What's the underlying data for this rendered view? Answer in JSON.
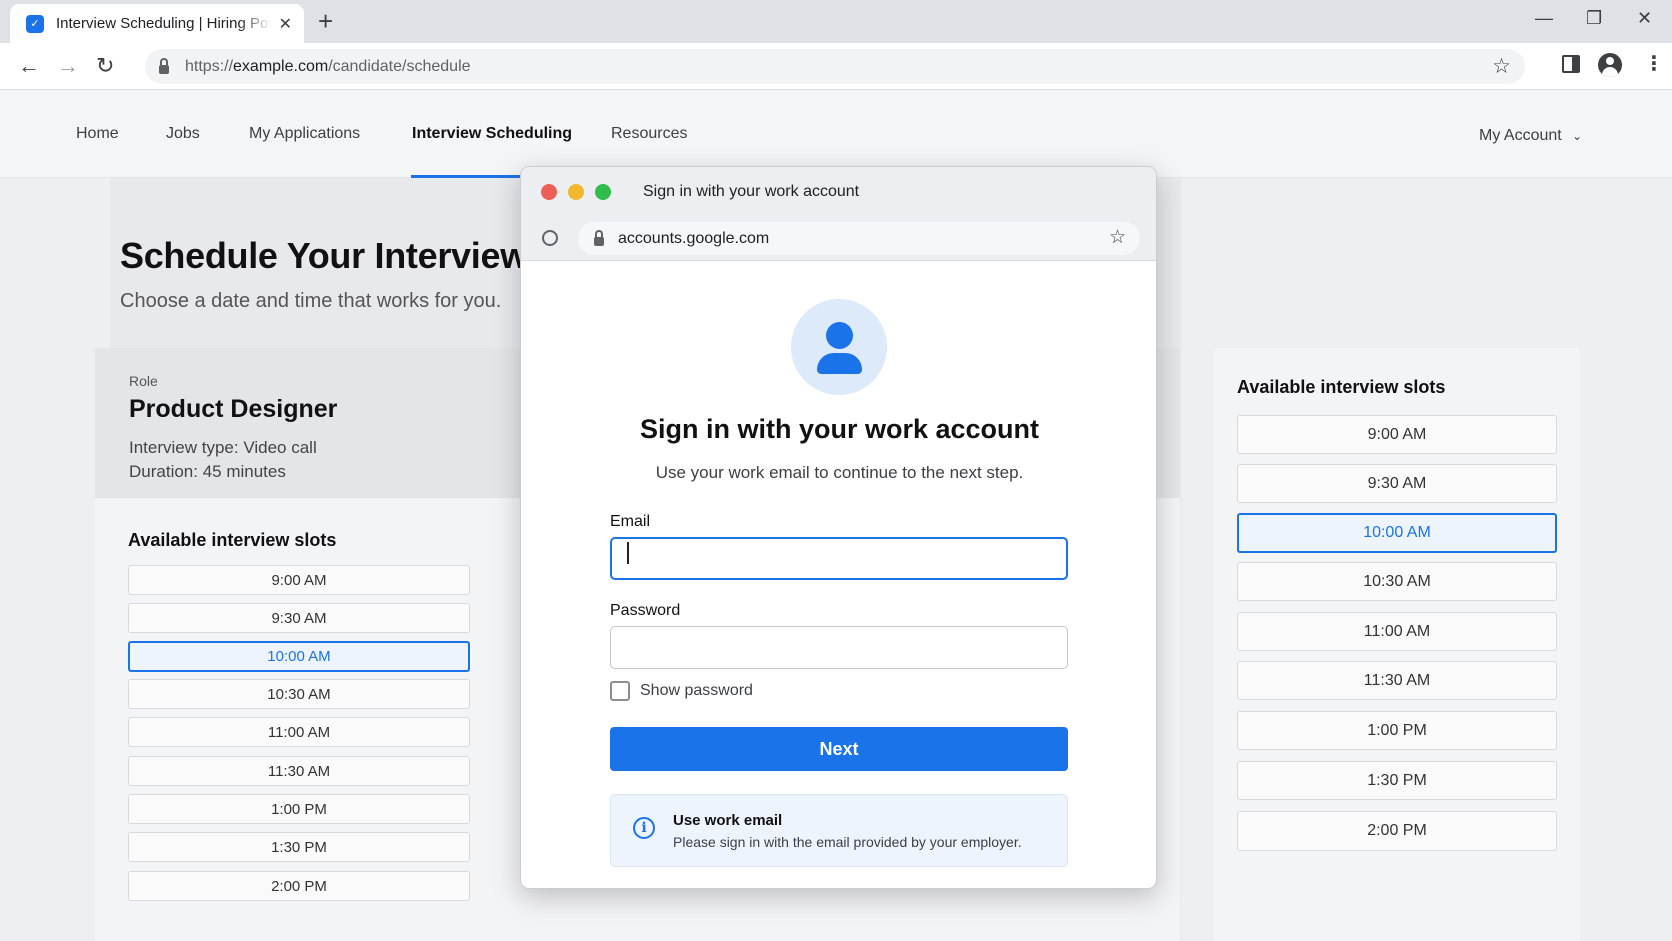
{
  "browser": {
    "tab_title": "Interview Scheduling | Hiring Portal",
    "tab_icon": "portal-favicon",
    "url_prefix": "https://",
    "url_host": "example.com",
    "url_path": "/candidate/schedule"
  },
  "site_nav": {
    "items": [
      "Home",
      "Jobs",
      "My Applications",
      "Interview Scheduling",
      "Resources"
    ],
    "active": "Interview Scheduling",
    "account_label": "My Account"
  },
  "page": {
    "title": "Schedule Your Interview",
    "subtitle": "Choose a date and time that works for you."
  },
  "role": {
    "label": "Role",
    "name": "Product Designer",
    "interview_type": "Interview type: Video call",
    "duration": "Duration: 45 minutes"
  },
  "slots": {
    "title": "Available interview slots",
    "times": [
      "9:00 AM",
      "9:30 AM",
      "10:00 AM",
      "10:30 AM",
      "11:00 AM",
      "11:30 AM",
      "1:00 PM",
      "1:30 PM",
      "2:00 PM"
    ],
    "selected": "10:00 AM"
  },
  "popup": {
    "window_title": "Sign in with your work account",
    "url": "accounts.google.com",
    "heading": "Sign in with your work account",
    "subheading": "Use your work email to continue to the next step.",
    "email_label": "Email",
    "email_value": "",
    "password_label": "Password",
    "password_value": "",
    "show_password_label": "Show password",
    "next_label": "Next",
    "notice_title": "Use work email",
    "notice_text": "Please sign in with the email provided by your employer."
  },
  "colors": {
    "accent": "#1a73e8",
    "traffic_red": "#ec5f57",
    "traffic_yellow": "#f0b72f",
    "traffic_green": "#2fbd4b"
  }
}
